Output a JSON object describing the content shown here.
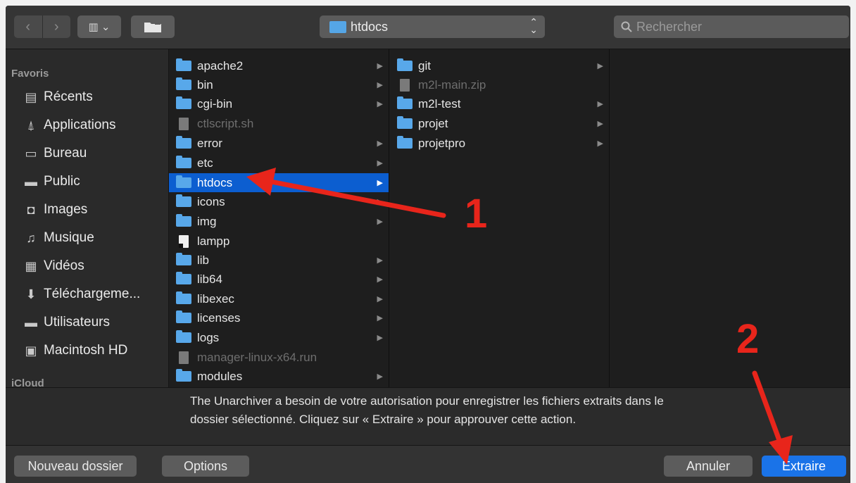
{
  "toolbar": {
    "nav_back": "‹",
    "nav_forward": "›",
    "view_mode": "▥ ⌄",
    "path_popup": "htdocs",
    "search_placeholder": "Rechercher"
  },
  "sidebar": {
    "favorites_header": "Favoris",
    "items": [
      {
        "label": "Récents",
        "icon": "recents-icon"
      },
      {
        "label": "Applications",
        "icon": "applications-icon"
      },
      {
        "label": "Bureau",
        "icon": "desktop-icon"
      },
      {
        "label": "Public",
        "icon": "folder-icon"
      },
      {
        "label": "Images",
        "icon": "camera-icon"
      },
      {
        "label": "Musique",
        "icon": "music-icon"
      },
      {
        "label": "Vidéos",
        "icon": "film-icon"
      },
      {
        "label": "Téléchargeme...",
        "icon": "download-icon"
      },
      {
        "label": "Utilisateurs",
        "icon": "folder-icon"
      },
      {
        "label": "Macintosh HD",
        "icon": "drive-icon"
      }
    ],
    "icloud_header": "iCloud"
  },
  "column1": {
    "items": [
      {
        "label": "apache2",
        "kind": "folder",
        "chevron": true
      },
      {
        "label": "bin",
        "kind": "folder",
        "chevron": true
      },
      {
        "label": "cgi-bin",
        "kind": "folder",
        "chevron": true
      },
      {
        "label": "ctlscript.sh",
        "kind": "file-dim",
        "chevron": false
      },
      {
        "label": "error",
        "kind": "folder",
        "chevron": true
      },
      {
        "label": "etc",
        "kind": "folder",
        "chevron": true
      },
      {
        "label": "htdocs",
        "kind": "folder",
        "chevron": true,
        "selected": true
      },
      {
        "label": "icons",
        "kind": "folder",
        "chevron": true
      },
      {
        "label": "img",
        "kind": "folder",
        "chevron": true
      },
      {
        "label": "lampp",
        "kind": "exec",
        "chevron": false
      },
      {
        "label": "lib",
        "kind": "folder",
        "chevron": true
      },
      {
        "label": "lib64",
        "kind": "folder",
        "chevron": true
      },
      {
        "label": "libexec",
        "kind": "folder",
        "chevron": true
      },
      {
        "label": "licenses",
        "kind": "folder",
        "chevron": true
      },
      {
        "label": "logs",
        "kind": "folder",
        "chevron": true
      },
      {
        "label": "manager-linux-x64.run",
        "kind": "file-dim",
        "chevron": false
      },
      {
        "label": "modules",
        "kind": "folder",
        "chevron": true
      }
    ]
  },
  "column2": {
    "items": [
      {
        "label": "git",
        "kind": "folder",
        "chevron": true
      },
      {
        "label": "m2l-main.zip",
        "kind": "file-dim",
        "chevron": false
      },
      {
        "label": "m2l-test",
        "kind": "folder",
        "chevron": true
      },
      {
        "label": "projet",
        "kind": "folder",
        "chevron": true
      },
      {
        "label": "projetpro",
        "kind": "folder",
        "chevron": true
      }
    ]
  },
  "message": {
    "text": "The Unarchiver a besoin de votre autorisation pour enregistrer les fichiers extraits dans le dossier sélectionné. Cliquez sur « Extraire » pour approuver cette action."
  },
  "buttons": {
    "new_folder": "Nouveau dossier",
    "options": "Options",
    "cancel": "Annuler",
    "extract": "Extraire"
  },
  "annotations": {
    "step1": "1",
    "step2": "2",
    "color": "#e8251b"
  }
}
